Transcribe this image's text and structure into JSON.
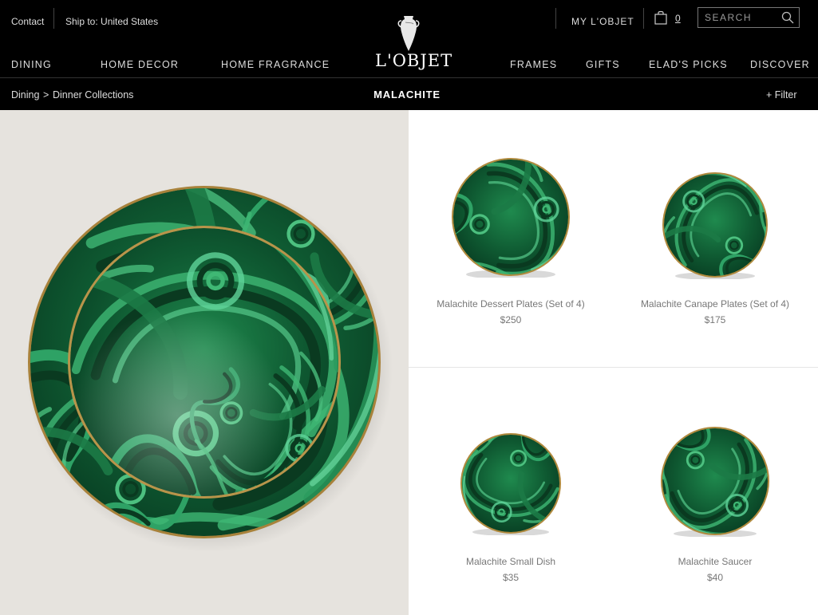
{
  "header": {
    "contact_label": "Contact",
    "ship_label": "Ship to: United States",
    "logo_text": "L'OBJET",
    "account_label": "MY L'OBJET",
    "cart_count": "0",
    "search_placeholder": "SEARCH"
  },
  "nav": {
    "left": [
      "DINING",
      "HOME DECOR",
      "HOME FRAGRANCE"
    ],
    "right": [
      "FRAMES",
      "GIFTS",
      "ELAD'S PICKS",
      "DISCOVER"
    ]
  },
  "subheader": {
    "breadcrumb": [
      "Dining",
      ">",
      "Dinner Collections"
    ],
    "title": "MALACHITE",
    "filter_label": "+ Filter"
  },
  "products": [
    {
      "name": "Malachite Dessert Plates (Set of 4)",
      "price": "$250"
    },
    {
      "name": "Malachite Canape Plates (Set of 4)",
      "price": "$175"
    },
    {
      "name": "Malachite Small Dish",
      "price": "$35"
    },
    {
      "name": "Malachite Saucer",
      "price": "$40"
    }
  ],
  "colors": {
    "header_bg": "#000000",
    "malachite_dark": "#0b3d24",
    "malachite_mid": "#1a7a45",
    "malachite_light": "#3fb874",
    "gold_rim": "#b08a3e"
  }
}
